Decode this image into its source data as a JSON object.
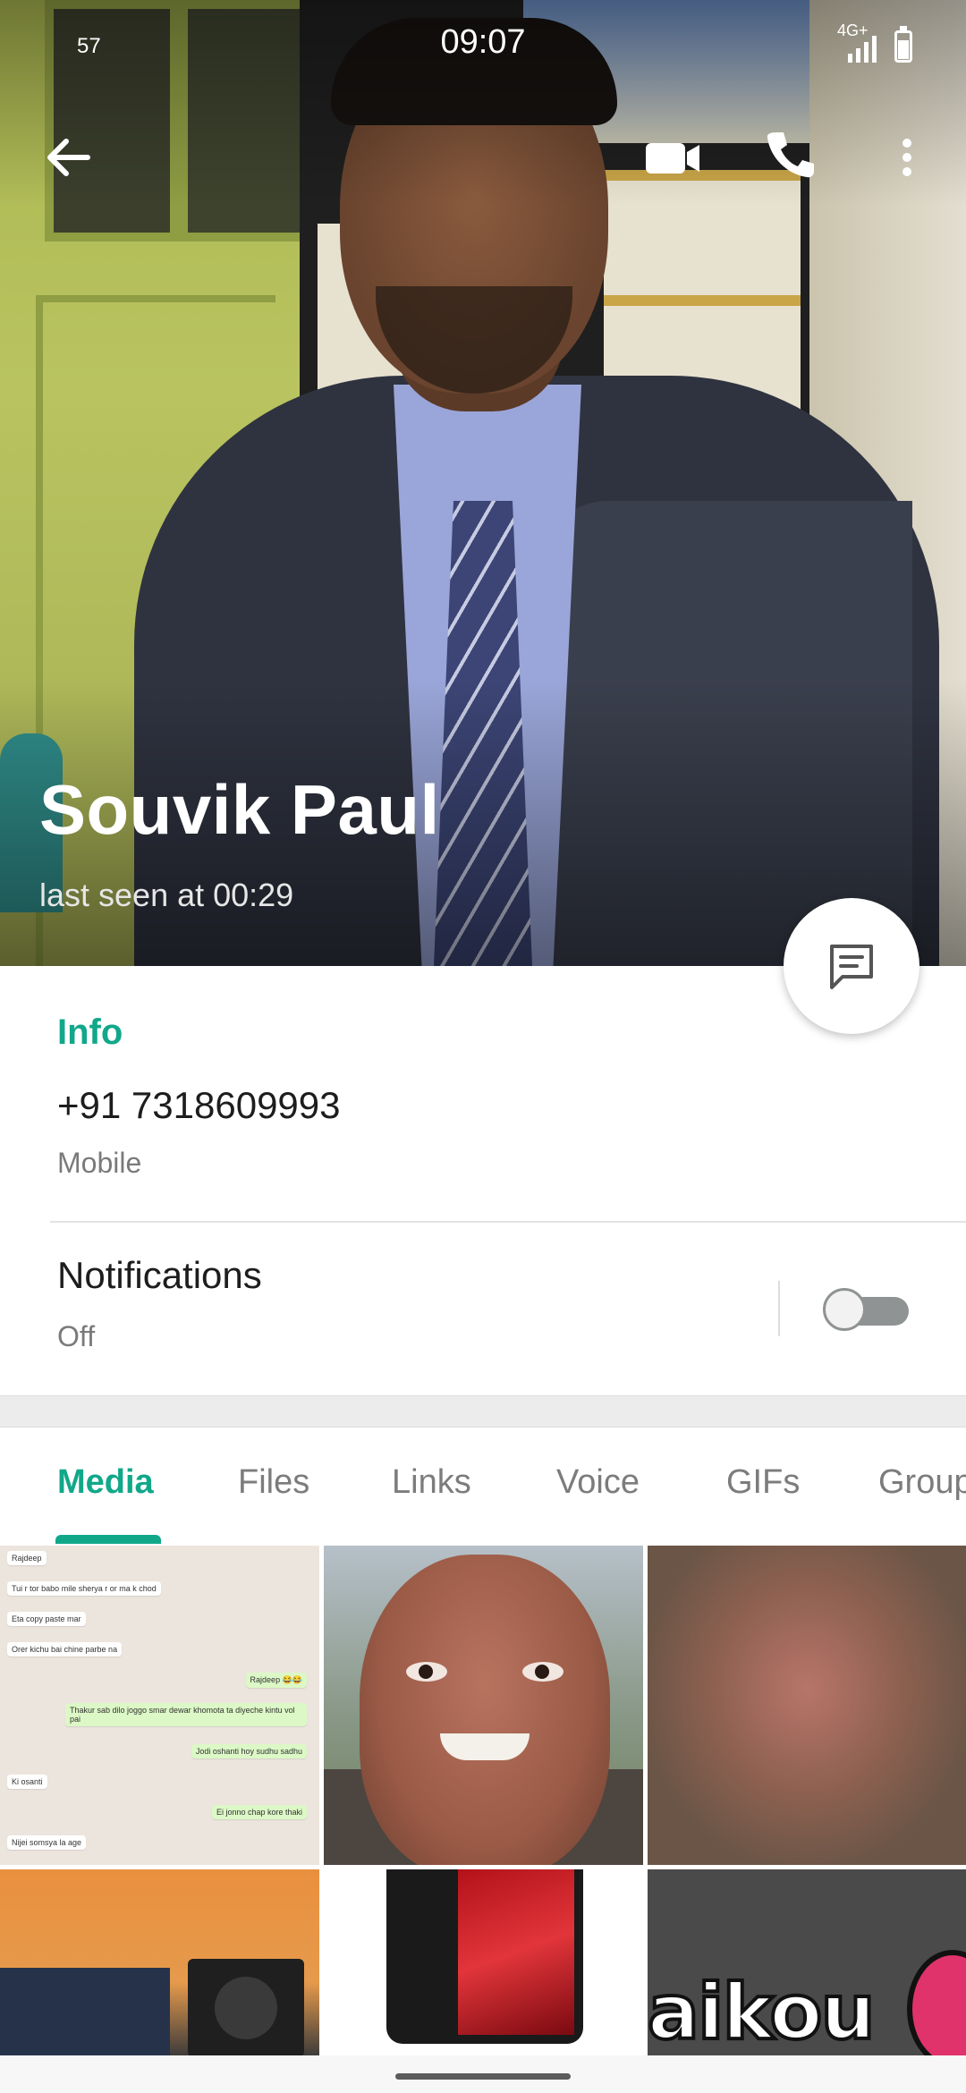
{
  "status_bar": {
    "left_text": "57",
    "time": "09:07",
    "network": "4G+"
  },
  "contact": {
    "name": "Souvik Paul",
    "last_seen": "last seen at 00:29"
  },
  "info": {
    "section_label": "Info",
    "phone": "+91 7318609993",
    "phone_type": "Mobile"
  },
  "notifications": {
    "label": "Notifications",
    "state": "Off",
    "enabled": false
  },
  "tabs": [
    {
      "label": "Media",
      "active": true
    },
    {
      "label": "Files",
      "active": false
    },
    {
      "label": "Links",
      "active": false
    },
    {
      "label": "Voice",
      "active": false
    },
    {
      "label": "GIFs",
      "active": false
    },
    {
      "label": "Groups",
      "active": false
    }
  ],
  "chat_thumb": {
    "lines": [
      {
        "text": "Rajdeep",
        "out": false
      },
      {
        "text": "Tui r tor babo mile sherya r or ma k chod",
        "out": false
      },
      {
        "text": "Eta copy paste mar",
        "out": false
      },
      {
        "text": "Orer kichu bai chine parbe na",
        "out": false
      },
      {
        "text": "Rajdeep 😂😂",
        "out": true
      },
      {
        "text": "Thakur sab dilo joggo smar dewar khomota ta diyeche kintu vol pai",
        "out": true
      },
      {
        "text": "Jodi oshanti hoy sudhu sadhu",
        "out": true
      },
      {
        "text": "Ki osanti",
        "out": false
      },
      {
        "text": "Ei jonno chap kore thaki",
        "out": true
      },
      {
        "text": "Nijei somsya la age",
        "out": false
      }
    ]
  },
  "sticker_text": "aikou",
  "colors": {
    "accent": "#11a88a",
    "text_primary": "#1d1d1d",
    "text_secondary": "#7a7a7a"
  },
  "icons": {
    "back": "arrow-left-icon",
    "video": "video-camera-icon",
    "call": "phone-icon",
    "more": "more-vertical-icon",
    "message": "message-icon"
  }
}
